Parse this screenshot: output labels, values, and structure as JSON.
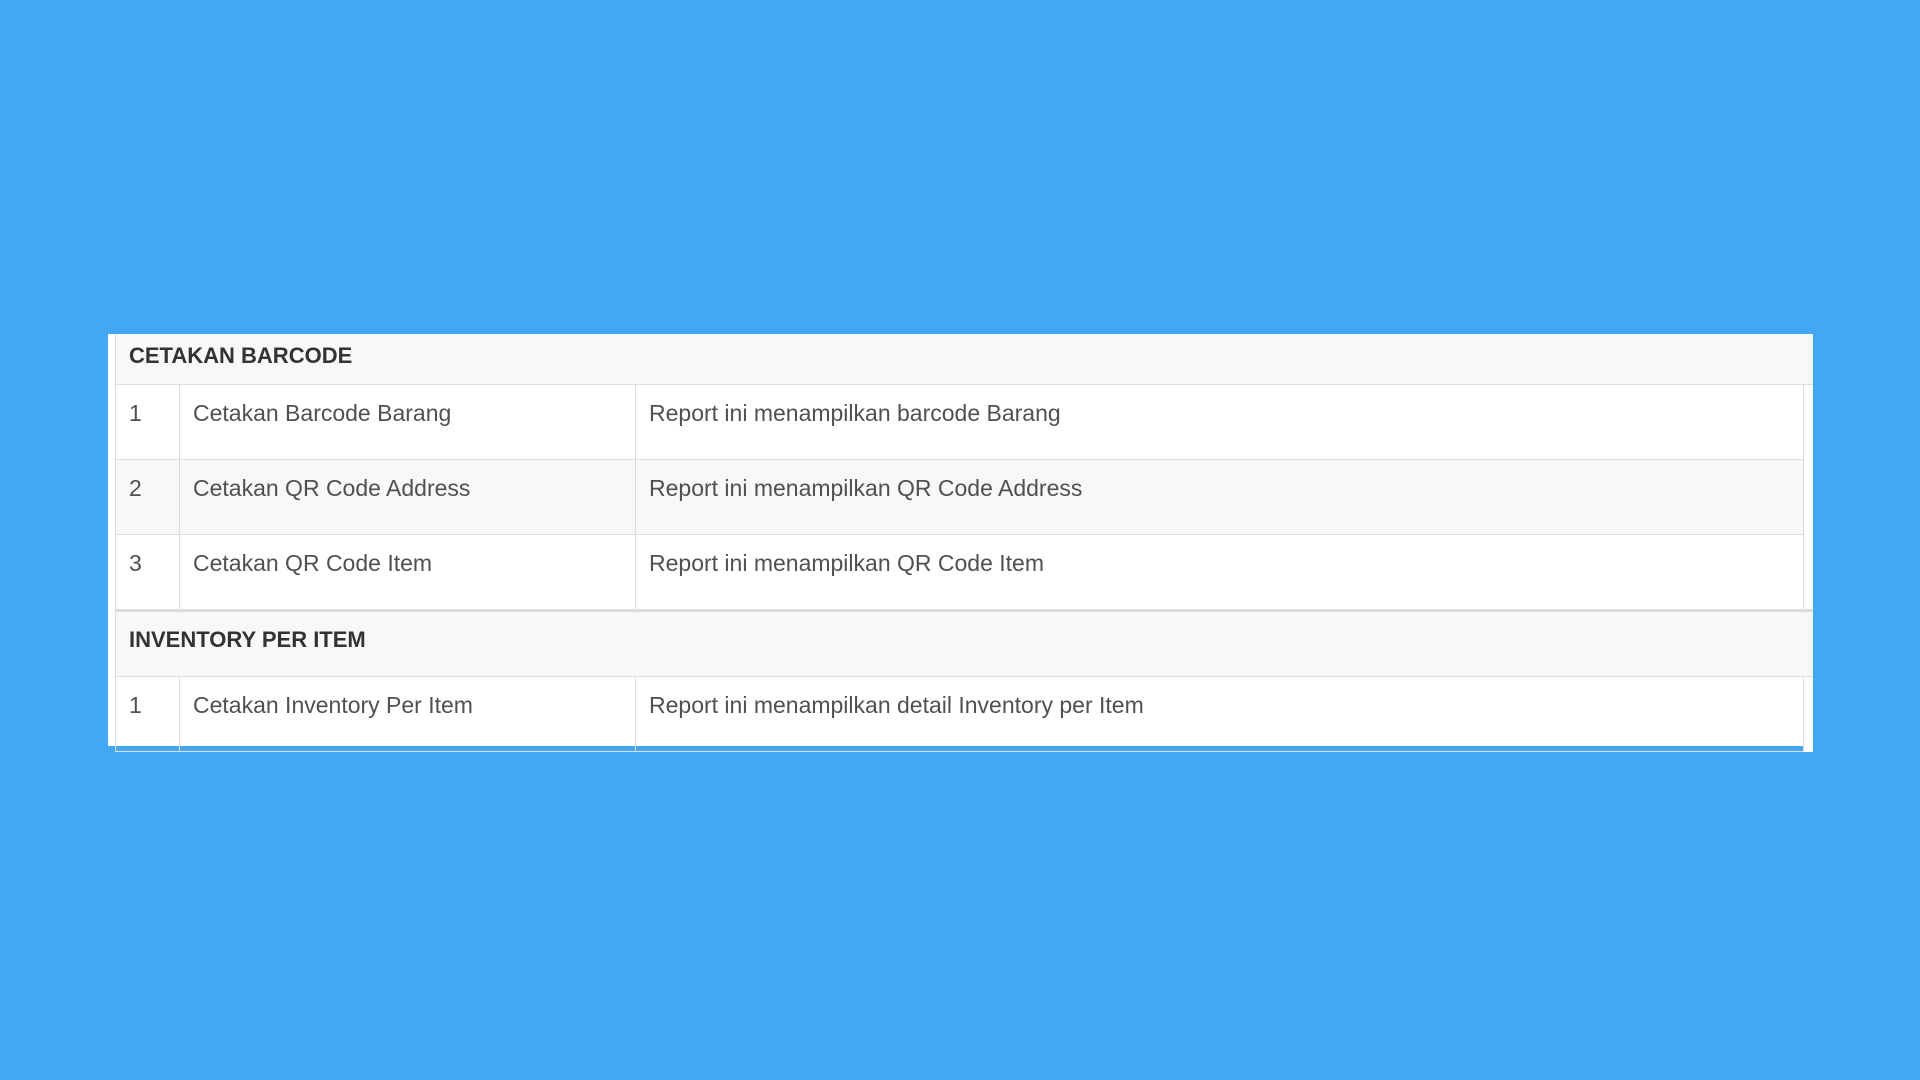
{
  "sections": [
    {
      "title": "CETAKAN BARCODE",
      "rows": [
        {
          "no": "1",
          "name": "Cetakan Barcode Barang",
          "description": "Report ini menampilkan barcode Barang"
        },
        {
          "no": "2",
          "name": "Cetakan QR Code Address",
          "description": "Report ini menampilkan QR Code Address"
        },
        {
          "no": "3",
          "name": "Cetakan QR Code Item",
          "description": "Report ini menampilkan QR Code Item"
        }
      ]
    },
    {
      "title": "INVENTORY PER ITEM",
      "rows": [
        {
          "no": "1",
          "name": "Cetakan Inventory Per Item",
          "description": "Report ini menampilkan detail Inventory per Item"
        }
      ]
    }
  ],
  "colors": {
    "background": "#42a8f5",
    "panel": "#ffffff",
    "header_row": "#f8f8f8",
    "border": "#dedede"
  }
}
